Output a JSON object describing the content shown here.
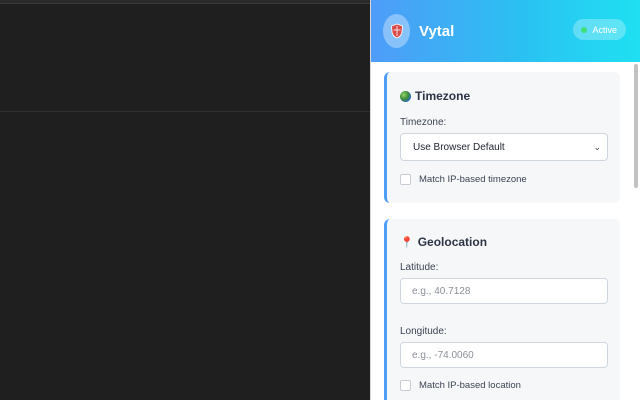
{
  "header": {
    "title": "Vytal",
    "status": "Active",
    "logo_icon": "shield-logo-icon"
  },
  "timezone_card": {
    "title": "Timezone",
    "icon": "globe-icon",
    "field_label": "Timezone:",
    "select_value": "Use Browser Default",
    "checkbox_label": "Match IP-based timezone",
    "checkbox_checked": false
  },
  "geolocation_card": {
    "title": "Geolocation",
    "icon": "pin-icon",
    "latitude_label": "Latitude:",
    "latitude_placeholder": "e.g., 40.7128",
    "longitude_label": "Longitude:",
    "longitude_placeholder": "e.g., -74.0060",
    "checkbox_label": "Match IP-based location",
    "checkbox_checked": false
  },
  "colors": {
    "accent": "#4e9df7",
    "header_gradient_start": "#4f9cf8",
    "header_gradient_end": "#1fe0f2",
    "status_dot": "#3fe07a",
    "page_background": "#1f1f1f",
    "card_background": "#f5f7f9"
  }
}
